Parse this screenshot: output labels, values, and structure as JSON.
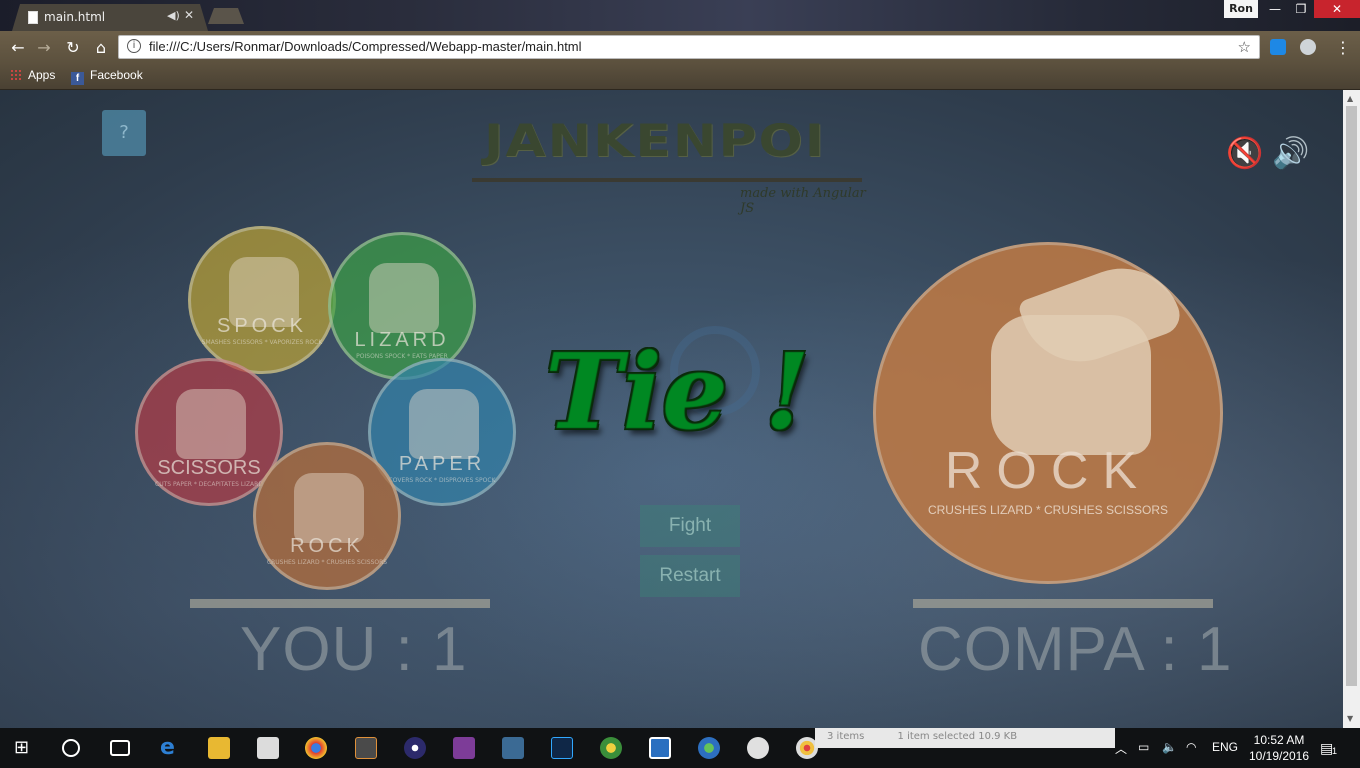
{
  "browser": {
    "tab_title": "main.html",
    "user_label": "Ron",
    "url": "file:///C:/Users/Ronmar/Downloads/Compressed/Webapp-master/main.html",
    "bookmarks": [
      "Apps",
      "Facebook"
    ]
  },
  "game": {
    "help_label": "?",
    "logo_title": "JANKENPOI",
    "logo_tagline": "made with Angular JS",
    "choices": [
      {
        "name": "SPOCK",
        "desc": "SMASHES SCISSORS * VAPORIZES ROCK"
      },
      {
        "name": "LIZARD",
        "desc": "POISONS SPOCK * EATS PAPER"
      },
      {
        "name": "SCISSORS",
        "desc": "CUTS PAPER * DECAPITATES LIZARD"
      },
      {
        "name": "PAPER",
        "desc": "COVERS ROCK * DISPROVES SPOCK"
      },
      {
        "name": "ROCK",
        "desc": "CRUSHES LIZARD * CRUSHES SCISSORS"
      }
    ],
    "result_text": "Tie !",
    "fight_label": "Fight",
    "restart_label": "Restart",
    "cpu_choice": {
      "name": "ROCK",
      "desc": "CRUSHES LIZARD * CRUSHES SCISSORS"
    },
    "player_score_text": "YOU : 1",
    "cpu_score_text": "COMPA : 1"
  },
  "taskbar": {
    "explorer_items": "3 items",
    "explorer_selected": "1 item selected  10.9 KB",
    "language": "ENG",
    "time": "10:52 AM",
    "date": "10/19/2016",
    "notification_count": "1"
  }
}
